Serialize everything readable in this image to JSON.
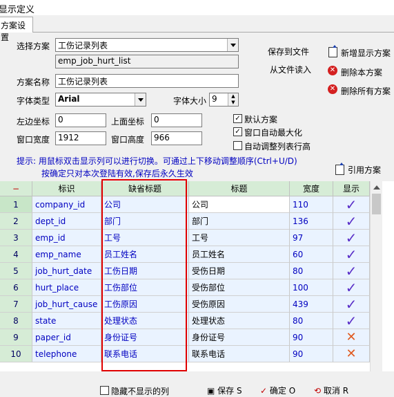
{
  "window": {
    "title": "显示定义"
  },
  "tabs": [
    {
      "label": "方案设置"
    }
  ],
  "form": {
    "scheme_label": "选择方案",
    "scheme_value": "工伤记录列表",
    "table_name": "emp_job_hurt_list",
    "scheme_name_label": "方案名称",
    "scheme_name_value": "工伤记录列表",
    "font_type_label": "字体类型",
    "font_type_value": "Arial",
    "font_size_label": "字体大小",
    "font_size_value": "9",
    "left_label": "左边坐标",
    "left_value": "0",
    "top_label": "上面坐标",
    "top_value": "0",
    "win_width_label": "窗口宽度",
    "win_width_value": "1912",
    "win_height_label": "窗口高度",
    "win_height_value": "966"
  },
  "actions": {
    "save_to_file": "保存到文件",
    "load_from_file": "从文件读入",
    "add_scheme": "新增显示方案",
    "delete_scheme": "删除本方案",
    "delete_all": "删除所有方案",
    "apply_scheme": "引用方案"
  },
  "options": {
    "default_scheme": {
      "label": "默认方案",
      "checked": true
    },
    "maximize": {
      "label": "窗口自动最大化",
      "checked": true
    },
    "auto_row_height": {
      "label": "自动调整列表行高",
      "checked": false
    }
  },
  "hint": {
    "line1": "提示: 用鼠标双击显示列可以进行切换。可通过上下移动调整顺序(Ctrl+U/D)",
    "line2": "按确定只对本次登陆有效,保存后永久生效"
  },
  "grid": {
    "headers": {
      "num": "−",
      "id": "标识",
      "default_title": "缺省标题",
      "title": "标题",
      "width": "宽度",
      "show": "显示"
    },
    "rows": [
      {
        "num": "1",
        "id": "company_id",
        "default_title": "公司",
        "title": "公司",
        "width": "110",
        "show": true
      },
      {
        "num": "2",
        "id": "dept_id",
        "default_title": "部门",
        "title": "部门",
        "width": "136",
        "show": true
      },
      {
        "num": "3",
        "id": "emp_id",
        "default_title": "工号",
        "title": "工号",
        "width": "97",
        "show": true
      },
      {
        "num": "4",
        "id": "emp_name",
        "default_title": "员工姓名",
        "title": "员工姓名",
        "width": "60",
        "show": true
      },
      {
        "num": "5",
        "id": "job_hurt_date",
        "default_title": "工伤日期",
        "title": "受伤日期",
        "width": "80",
        "show": true
      },
      {
        "num": "6",
        "id": "hurt_place",
        "default_title": "工伤部位",
        "title": "受伤部位",
        "width": "100",
        "show": true
      },
      {
        "num": "7",
        "id": "job_hurt_cause",
        "default_title": "工伤原因",
        "title": "受伤原因",
        "width": "439",
        "show": true
      },
      {
        "num": "8",
        "id": "state",
        "default_title": "处理状态",
        "title": "处理状态",
        "width": "80",
        "show": true
      },
      {
        "num": "9",
        "id": "paper_id",
        "default_title": "身份证号",
        "title": "身份证号",
        "width": "90",
        "show": false
      },
      {
        "num": "10",
        "id": "telephone",
        "default_title": "联系电话",
        "title": "联系电话",
        "width": "90",
        "show": false
      }
    ]
  },
  "bottom": {
    "hide_label": "隐藏不显示的列",
    "save_label": "保存 S",
    "ok_label": "确定 O",
    "cancel_label": "取消 R"
  },
  "colors": {
    "highlight_box": "#e00000",
    "check": "#5a2fc8",
    "cross": "#e05a20"
  }
}
